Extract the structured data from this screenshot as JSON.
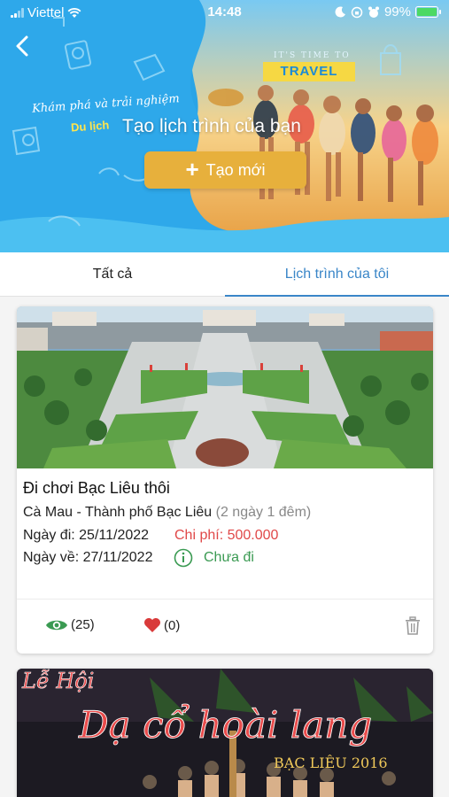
{
  "status_bar": {
    "carrier": "Viettel",
    "time": "14:48",
    "battery": "99%"
  },
  "banner": {
    "slogan_line1": "Khám phá và trải nghiệm",
    "slogan_line2": "Du lịch",
    "title": "Tạo lịch trình của bạn",
    "create_button": "Tạo mới",
    "travel_sign_top": "IT'S TIME TO",
    "travel_sign_main": "TRAVEL"
  },
  "tabs": [
    {
      "label": "Tất cả",
      "active": false
    },
    {
      "label": "Lịch trình của tôi",
      "active": true
    }
  ],
  "trips": [
    {
      "title": "Đi chơi Bạc Liêu thôi",
      "route": "Cà Mau - Thành phố Bạc Liêu",
      "duration": "(2 ngày 1 đêm)",
      "depart_label": "Ngày đi: 25/11/2022",
      "return_label": "Ngày về: 27/11/2022",
      "cost_label": "Chi phí: 500.000",
      "status": "Chưa đi",
      "views": "(25)",
      "likes": "(0)"
    },
    {
      "banner_text_1": "Lễ Hội",
      "banner_text_2": "Dạ cổ hoài lang",
      "banner_text_3": "BẠC LIÊU 2016"
    }
  ],
  "colors": {
    "accent_blue": "#3a86c8",
    "create_button": "#e7b03c",
    "cost_red": "#e04848",
    "status_green": "#3a9a52",
    "eye_green": "#3a9a52",
    "heart_red": "#d93a3a"
  }
}
